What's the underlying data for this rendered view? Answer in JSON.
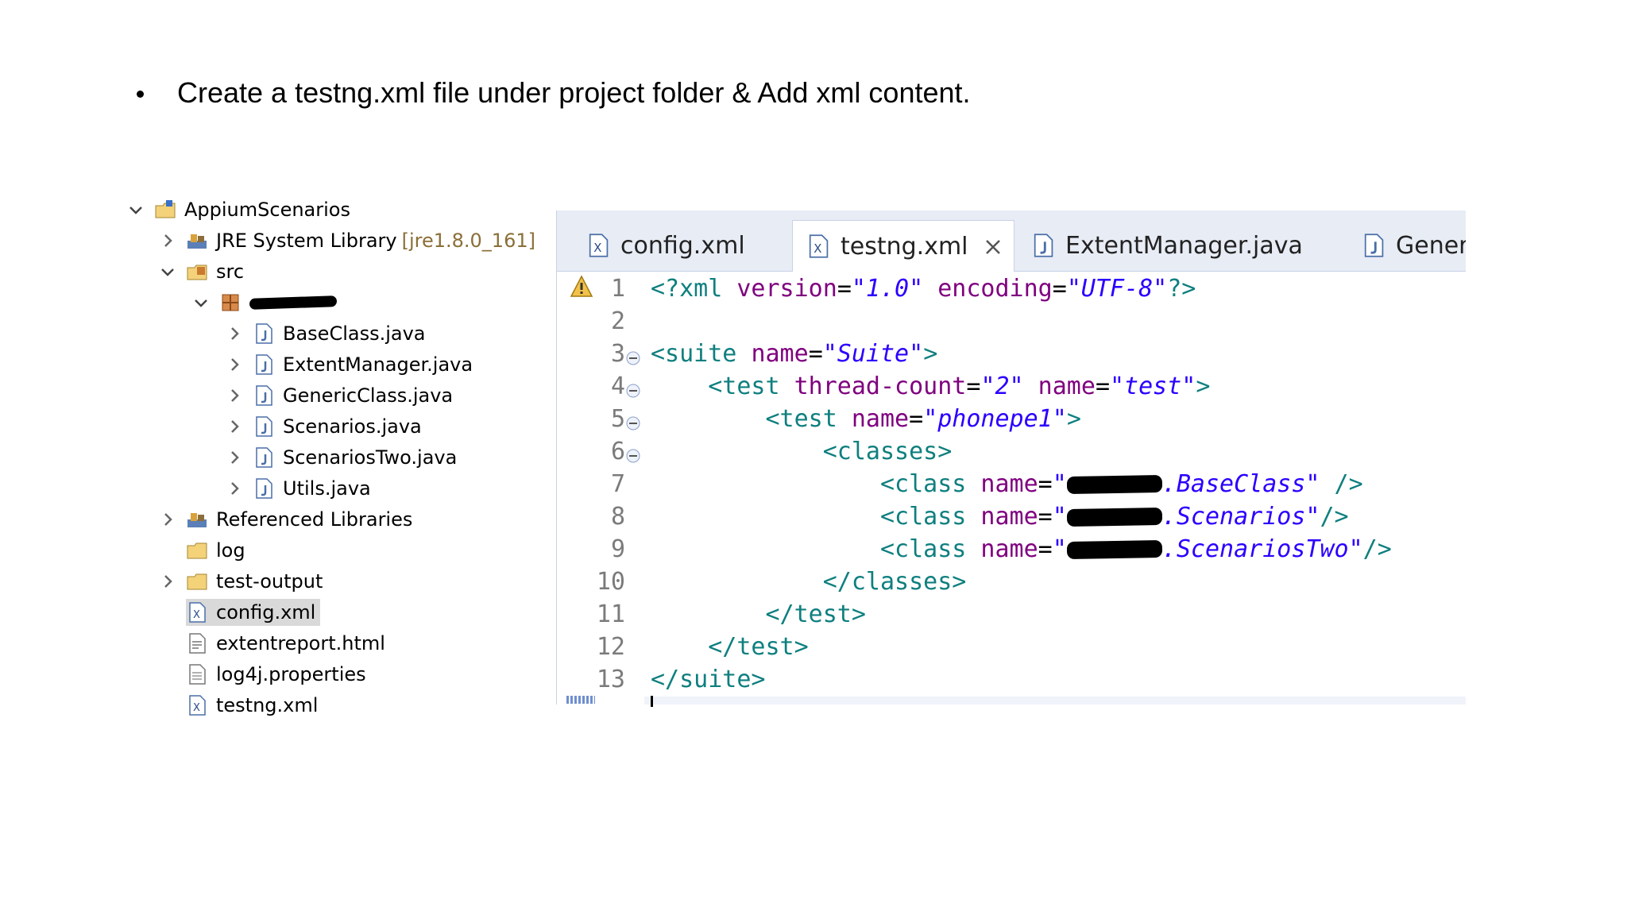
{
  "bullet_text": "Create a testng.xml file under project folder & Add xml content.",
  "tree": {
    "project": "AppiumScenarios",
    "jre_label": "JRE System Library",
    "jre_version": "[jre1.8.0_161]",
    "src": "src",
    "files": [
      "BaseClass.java",
      "ExtentManager.java",
      "GenericClass.java",
      "Scenarios.java",
      "ScenariosTwo.java",
      "Utils.java"
    ],
    "ref_libs": "Referenced Libraries",
    "log": "log",
    "test_output": "test-output",
    "config_xml": "config.xml",
    "extentreport": "extentreport.html",
    "log4j": "log4j.properties",
    "testng_xml": "testng.xml"
  },
  "editor": {
    "tabs": [
      "config.xml",
      "testng.xml",
      "ExtentManager.java",
      "Generi"
    ],
    "active_tab": "testng.xml",
    "line_numbers": [
      "1",
      "2",
      "3",
      "4",
      "5",
      "6",
      "7",
      "8",
      "9",
      "10",
      "11",
      "12",
      "13"
    ],
    "code": {
      "l1_open": "<?xml ",
      "l1_attr1": "version",
      "l1_eq1": "=",
      "l1_val1": "\"1.0\"",
      "l1_attr2": " encoding",
      "l1_eq2": "=",
      "l1_val2": "\"UTF-8\"",
      "l1_close": "?>",
      "l3_tag": "<suite ",
      "l3_attr": "name",
      "l3_val": "\"Suite\"",
      "l3_close": ">",
      "l4_tag": "<test ",
      "l4_attr1": "thread-count",
      "l4_val1": "\"2\"",
      "l4_attr2": " name",
      "l4_val2": "\"test\"",
      "l4_close": ">",
      "l5_tag": "<test ",
      "l5_attr": "name",
      "l5_val": "\"phonepe1\"",
      "l5_close": ">",
      "l6": "<classes>",
      "class_tag": "<class ",
      "class_attr": "name",
      "l7_val_end": ".BaseClass\"",
      "l7_close": " />",
      "l8_val_end": ".Scenarios\"",
      "l8_close": "/>",
      "l9_val_end": ".ScenariosTwo\"",
      "l9_close": "/>",
      "l10": "</classes>",
      "l11": "</test>",
      "l12": "</test>",
      "l13": "</suite>",
      "quote_open": "\""
    }
  }
}
